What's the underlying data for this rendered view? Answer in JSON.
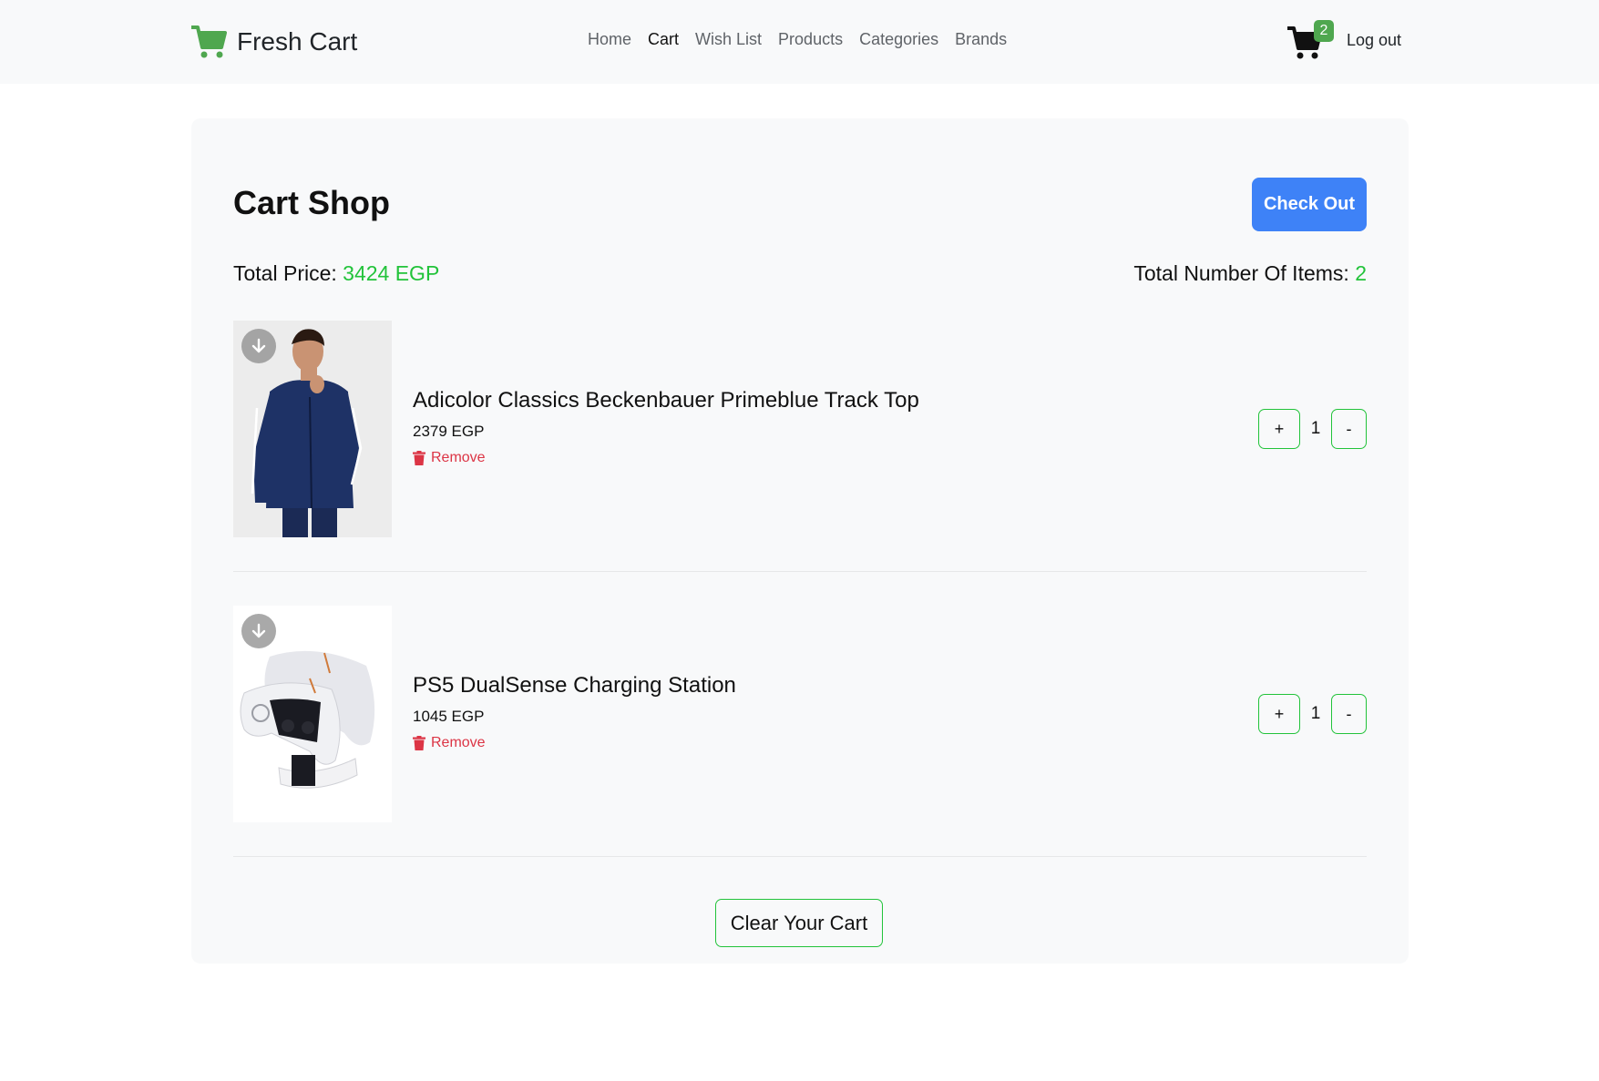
{
  "brand": {
    "name": "Fresh Cart",
    "icon": "cart-icon",
    "accent_color": "#4fa74f"
  },
  "nav": {
    "links": [
      {
        "label": "Home",
        "active": false
      },
      {
        "label": "Cart",
        "active": true
      },
      {
        "label": "Wish List",
        "active": false
      },
      {
        "label": "Products",
        "active": false
      },
      {
        "label": "Categories",
        "active": false
      },
      {
        "label": "Brands",
        "active": false
      }
    ],
    "cart_count": "2",
    "logout_label": "Log out"
  },
  "cart": {
    "title": "Cart Shop",
    "checkout_label": "Check Out",
    "checkout_color": "#3e82f7",
    "total_price_label": "Total Price:",
    "total_price_value": "3424 EGP",
    "total_items_label": "Total Number Of Items:",
    "total_items_value": "2",
    "highlight_color": "#22c33a",
    "items": [
      {
        "title": "Adicolor Classics Beckenbauer Primeblue Track Top",
        "price": "2379 EGP",
        "remove_label": "Remove",
        "quantity": "1",
        "plus_label": "+",
        "minus_label": "-"
      },
      {
        "title": "PS5 DualSense Charging Station",
        "price": "1045 EGP",
        "remove_label": "Remove",
        "quantity": "1",
        "plus_label": "+",
        "minus_label": "-"
      }
    ],
    "clear_label": "Clear Your Cart"
  }
}
